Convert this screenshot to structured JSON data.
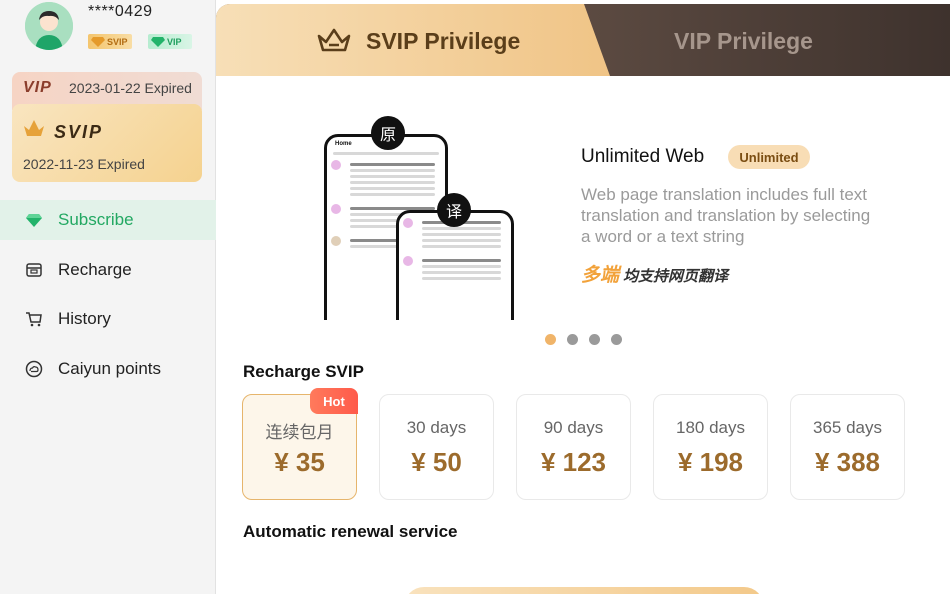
{
  "profile": {
    "username": "****0429",
    "badge_svip": "SVIP",
    "badge_vip": "VIP"
  },
  "membership_cards": {
    "vip": {
      "label": "VIP",
      "expiry": "2023-01-22 Expired"
    },
    "svip": {
      "label": "SVIP",
      "expiry": "2022-11-23 Expired"
    }
  },
  "sidebar": {
    "items": [
      {
        "label": "Subscribe",
        "icon": "diamond-icon",
        "active": true
      },
      {
        "label": "Recharge",
        "icon": "wallet-icon",
        "active": false
      },
      {
        "label": "History",
        "icon": "cart-icon",
        "active": false
      },
      {
        "label": "Caiyun points",
        "icon": "cloud-icon",
        "active": false
      }
    ]
  },
  "tabs": {
    "svip": "SVIP Privilege",
    "vip": "VIP Privilege"
  },
  "feature": {
    "title": "Unlimited Web",
    "tag": "Unlimited",
    "description": "Web page translation includes full text translation and translation by selecting a word or a text string",
    "slogan_highlight": "多端",
    "slogan_rest": "均支持网页翻译",
    "bubble_original": "原",
    "bubble_translated": "译",
    "phone_header": "Home"
  },
  "carousel": {
    "count": 4,
    "active_index": 0
  },
  "recharge": {
    "title": "Recharge SVIP",
    "plans": [
      {
        "name": "连续包月",
        "price": "¥ 35",
        "selected": true,
        "hot_label": "Hot"
      },
      {
        "name": "30 days",
        "price": "¥ 50",
        "selected": false
      },
      {
        "name": "90 days",
        "price": "¥ 123",
        "selected": false
      },
      {
        "name": "180 days",
        "price": "¥ 198",
        "selected": false
      },
      {
        "name": "365 days",
        "price": "¥ 388",
        "selected": false
      }
    ]
  },
  "renewal": {
    "title": "Automatic renewal service"
  },
  "colors": {
    "accent_green": "#22a862",
    "gold": "#f0c486",
    "price": "#9c6b2c",
    "hot": "#ff5a4a"
  }
}
